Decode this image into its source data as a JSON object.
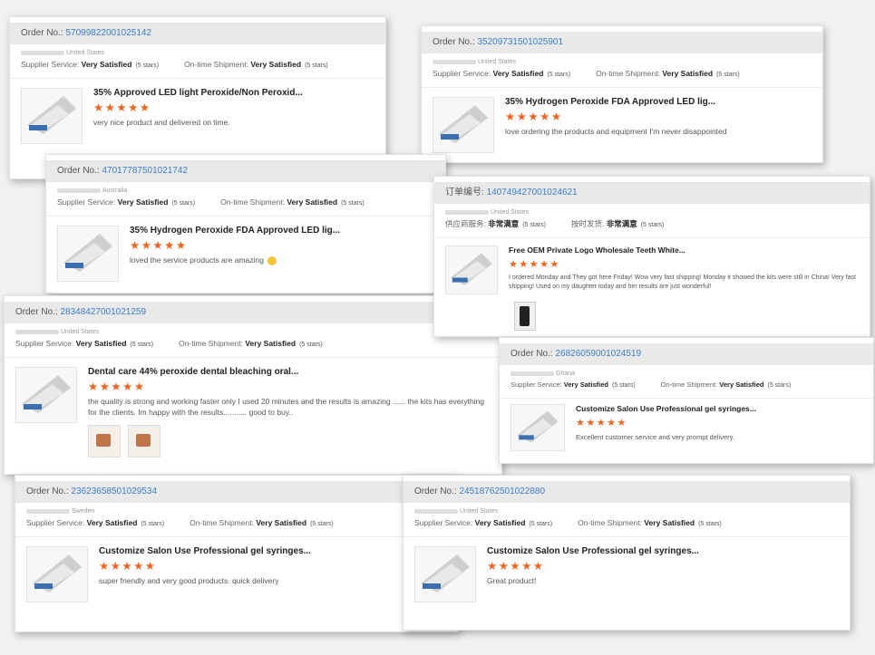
{
  "orders": [
    {
      "label": "Order No.:",
      "number": "57099822001025142",
      "country": "United States",
      "svc_label": "Supplier Service:",
      "svc_value": "Very Satisfied",
      "svc_stars": "(5 stars)",
      "ship_label": "On-time Shipment:",
      "ship_value": "Very Satisfied",
      "ship_stars": "(5 stars)",
      "product": "35% Approved LED light Peroxide/Non Peroxid...",
      "stars": "★★★★★",
      "comment": "very nice product and delivered on time."
    },
    {
      "label": "Order No.:",
      "number": "35209731501025901",
      "country": "United States",
      "svc_label": "Supplier Service:",
      "svc_value": "Very Satisfied",
      "svc_stars": "(5 stars)",
      "ship_label": "On-time Shipment:",
      "ship_value": "Very Satisfied",
      "ship_stars": "(5 stars)",
      "product": "35% Hydrogen Peroxide FDA Approved LED lig...",
      "stars": "★★★★★",
      "comment": "love ordering the products and equipment I'm never disappointed"
    },
    {
      "label": "Order No.:",
      "number": "47017787501021742",
      "country": "Australia",
      "svc_label": "Supplier Service:",
      "svc_value": "Very Satisfied",
      "svc_stars": "(5 stars)",
      "ship_label": "On-time Shipment:",
      "ship_value": "Very Satisfied",
      "ship_stars": "(5 stars)",
      "product": "35% Hydrogen Peroxide FDA Approved LED lig...",
      "stars": "★★★★★",
      "comment": "loved the service products are amazing"
    },
    {
      "label": "订单编号:",
      "number": "140749427001024621",
      "country": "United States",
      "svc_label": "供应商服务:",
      "svc_value": "非常满意",
      "svc_stars": "(5 stars)",
      "ship_label": "按时发货:",
      "ship_value": "非常满意",
      "ship_stars": "(5 stars)",
      "product": "Free OEM Private Logo Wholesale Teeth White...",
      "stars": "★★★★★",
      "comment": "I ordered Monday and They got here Friday! Wow very fast shipping! Monday it showed the kits were still in China! Very fast shipping! Used on my daughter today and her results are just wonderful!"
    },
    {
      "label": "Order No.:",
      "number": "28348427001021259",
      "country": "United States",
      "svc_label": "Supplier Service:",
      "svc_value": "Very Satisfied",
      "svc_stars": "(5 stars)",
      "ship_label": "On-time Shipment:",
      "ship_value": "Very Satisfied",
      "ship_stars": "(5 stars)",
      "product": "Dental care 44% peroxide dental bleaching oral...",
      "stars": "★★★★★",
      "comment": "the quality is strong and working faster only I used 20 minutes and the results is amazing ...... the kits has everything  for the clients. Im happy with the results........... good to buy.."
    },
    {
      "label": "Order No.:",
      "number": "26826059001024519",
      "country": "Ghana",
      "svc_label": "Supplier Service:",
      "svc_value": "Very Satisfied",
      "svc_stars": "(5 stars)",
      "ship_label": "On-time Shipment:",
      "ship_value": "Very Satisfied",
      "ship_stars": "(5 stars)",
      "product": "Customize Salon Use Professional gel syringes...",
      "stars": "★★★★★",
      "comment": "Excellent customer service and very prompt delivery."
    },
    {
      "label": "Order No.:",
      "number": "23623658501029534",
      "country": "Sweden",
      "svc_label": "Supplier Service:",
      "svc_value": "Very Satisfied",
      "svc_stars": "(5 stars)",
      "ship_label": "On-time Shipment:",
      "ship_value": "Very Satisfied",
      "ship_stars": "(5 stars)",
      "product": "Customize Salon Use Professional gel syringes...",
      "stars": "★★★★★",
      "comment": "super friendly and very good products. quick delivery"
    },
    {
      "label": "Order No.:",
      "number": "24518762501022880",
      "country": "United States",
      "svc_label": "Supplier Service:",
      "svc_value": "Very Satisfied",
      "svc_stars": "(5 stars)",
      "ship_label": "On-time Shipment:",
      "ship_value": "Very Satisfied",
      "ship_stars": "(5 stars)",
      "product": "Customize Salon Use Professional gel syringes...",
      "stars": "★★★★★",
      "comment": "Great product!"
    }
  ]
}
